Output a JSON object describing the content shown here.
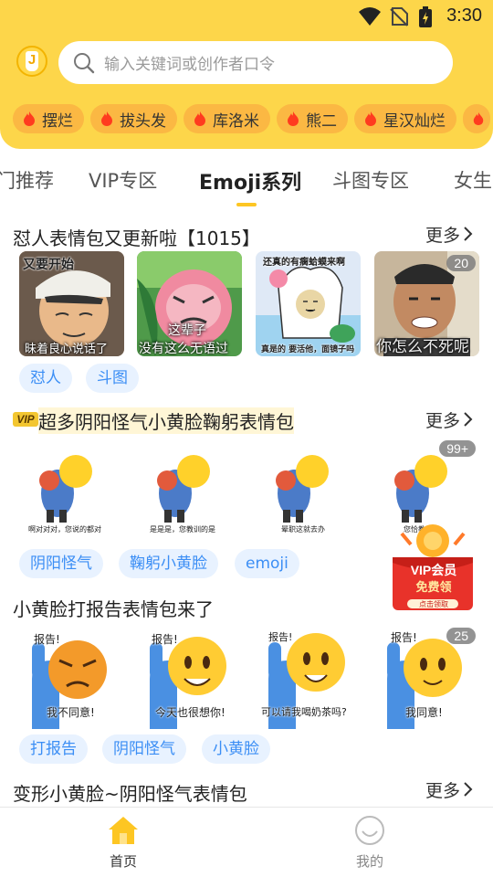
{
  "status": {
    "time": "3:30"
  },
  "search": {
    "placeholder": "输入关键词或创作者口令"
  },
  "hot_chips": [
    "摆烂",
    "拔头发",
    "库洛米",
    "熊二",
    "星汉灿烂"
  ],
  "tabs": [
    "门推荐",
    "VIP专区",
    "Emoji系列",
    "斗图专区",
    "女生"
  ],
  "sections": [
    {
      "title": "怼人表情包又更新啦【1015】",
      "more": "更多",
      "thumbs": [
        {
          "top": "又要开始",
          "bottom": "昧着良心说话了"
        },
        {
          "bottom1": "这辈子",
          "bottom2": "没有这么无语过"
        },
        {
          "top": "还真的有瘸蛤蟆来啊",
          "bottom": "真是的 要活他，面镜子吗"
        },
        {
          "bottom": "你怎么不死呢",
          "badge": "20"
        }
      ],
      "tags": [
        "怼人",
        "斗图"
      ]
    },
    {
      "vip_label": "VIP",
      "title": "超多阴阳怪气小黄脸鞠躬表情包",
      "more": "更多",
      "thumbs": [
        {
          "caption": "啊对对对，您说的都对"
        },
        {
          "caption": "是是是，您教训的是"
        },
        {
          "caption": "晕职这就去办"
        },
        {
          "caption": "您恰教训了",
          "badge": "99+"
        }
      ],
      "tags": [
        "阴阳怪气",
        "鞠躬小黄脸",
        "emoji"
      ]
    },
    {
      "title": "小黄脸打报告表情包来了",
      "thumbs": [
        {
          "top": "报告!",
          "bottom": "我不同意!"
        },
        {
          "top": "报告!",
          "bottom": "今天也很想你!"
        },
        {
          "top": "报告!",
          "bottom": "可以请我喝奶茶吗?"
        },
        {
          "top": "报告!",
          "bottom": "我同意!",
          "badge": "25"
        }
      ],
      "tags": [
        "打报告",
        "阴阳怪气",
        "小黄脸"
      ]
    },
    {
      "title": "变形小黄脸~阴阳怪气表情包",
      "more": "更多"
    }
  ],
  "vip_float": {
    "line1": "VIP会员",
    "line2": "免费领",
    "line3": "点击领取"
  },
  "nav": [
    {
      "label": "首页",
      "icon": "home-icon",
      "active": true
    },
    {
      "label": "我的",
      "icon": "smile-icon",
      "active": false
    }
  ],
  "colors": {
    "brand_yellow": "#fdd64a",
    "chip_orange": "#fbb843",
    "tag_blue": "#3b8ef5",
    "tag_bg": "#e8f2ff"
  }
}
